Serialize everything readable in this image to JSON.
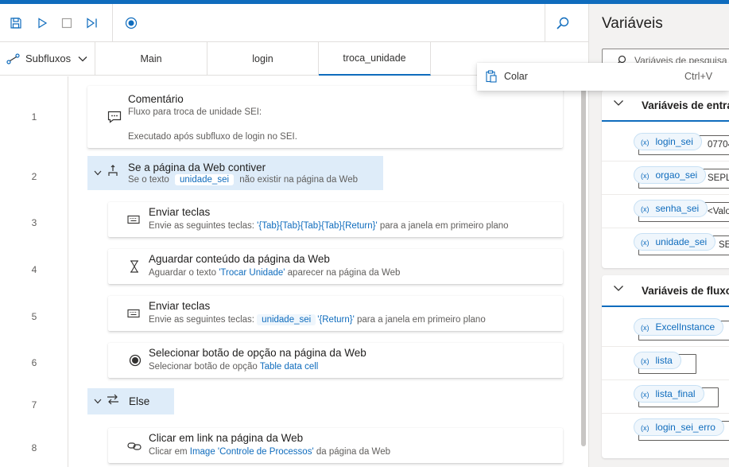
{
  "toolbar": {
    "buttons": [
      "save-icon",
      "run-icon",
      "stop-icon",
      "run-next-action-icon",
      "record-icon",
      "search-icon"
    ]
  },
  "subflows": {
    "label": "Subfluxos",
    "tabs": [
      {
        "label": "Main",
        "active": false
      },
      {
        "label": "login",
        "active": false
      },
      {
        "label": "troca_unidade",
        "active": true
      }
    ]
  },
  "actions": [
    {
      "line": "1",
      "title": "Comentário",
      "desc1": "Fluxo para troca de unidade SEI:",
      "desc2": "Executado após subfluxo de login no SEI.",
      "icon": "comment-icon"
    },
    {
      "line": "2",
      "title": "Se a página da Web contiver",
      "desc_pre": "Se o texto",
      "desc_var": "unidade_sei",
      "desc_post": "não existir na página da Web",
      "icon": "if-icon"
    },
    {
      "line": "3",
      "title": "Enviar teclas",
      "desc_pre": "Envie as seguintes teclas: ",
      "desc_val": "'{Tab}{Tab}{Tab}{Tab}{Return}'",
      "desc_post": " para a janela em primeiro plano",
      "icon": "keyboard-icon"
    },
    {
      "line": "4",
      "title": "Aguardar conteúdo da página da Web",
      "desc_pre": "Aguardar o texto ",
      "desc_val": "'Trocar Unidade'",
      "desc_post": " aparecer na página da Web",
      "icon": "hourglass-icon"
    },
    {
      "line": "5",
      "title": "Enviar teclas",
      "desc_pre": "Envie as seguintes teclas:",
      "desc_var": "unidade_sei",
      "desc_val": "'{Return}'",
      "desc_post": " para a janela em primeiro plano",
      "icon": "keyboard-icon"
    },
    {
      "line": "6",
      "title": "Selecionar botão de opção na página da Web",
      "desc_pre": "Selecionar botão de opção ",
      "desc_val": "Table data cell",
      "icon": "radio-icon"
    },
    {
      "line": "7",
      "title": "Else",
      "icon": "else-icon"
    },
    {
      "line": "8",
      "title": "Clicar em link na página da Web",
      "desc_pre": "Clicar em ",
      "desc_val": "Image 'Controle de Processos'",
      "desc_post": " da página da Web",
      "icon": "link-icon"
    }
  ],
  "variables": {
    "title": "Variáveis",
    "search_placeholder": "Variáveis de pesquisa",
    "input_section": {
      "title": "Variáveis de entra",
      "items": [
        {
          "name": "login_sei",
          "value": "07704"
        },
        {
          "name": "orgao_sei",
          "value": "SEPL"
        },
        {
          "name": "senha_sei",
          "value": "<Valo"
        },
        {
          "name": "unidade_sei",
          "value": "SEI"
        }
      ]
    },
    "flow_section": {
      "title": "Variáveis de fluxo",
      "items": [
        {
          "name": "ExcelInstance"
        },
        {
          "name": "lista"
        },
        {
          "name": "lista_final"
        },
        {
          "name": "login_sei_erro"
        }
      ]
    }
  },
  "context_menu": {
    "item_label": "Colar",
    "shortcut": "Ctrl+V"
  },
  "colors": {
    "accent": "#0f6cbd",
    "header_highlight": "#deecf9"
  }
}
